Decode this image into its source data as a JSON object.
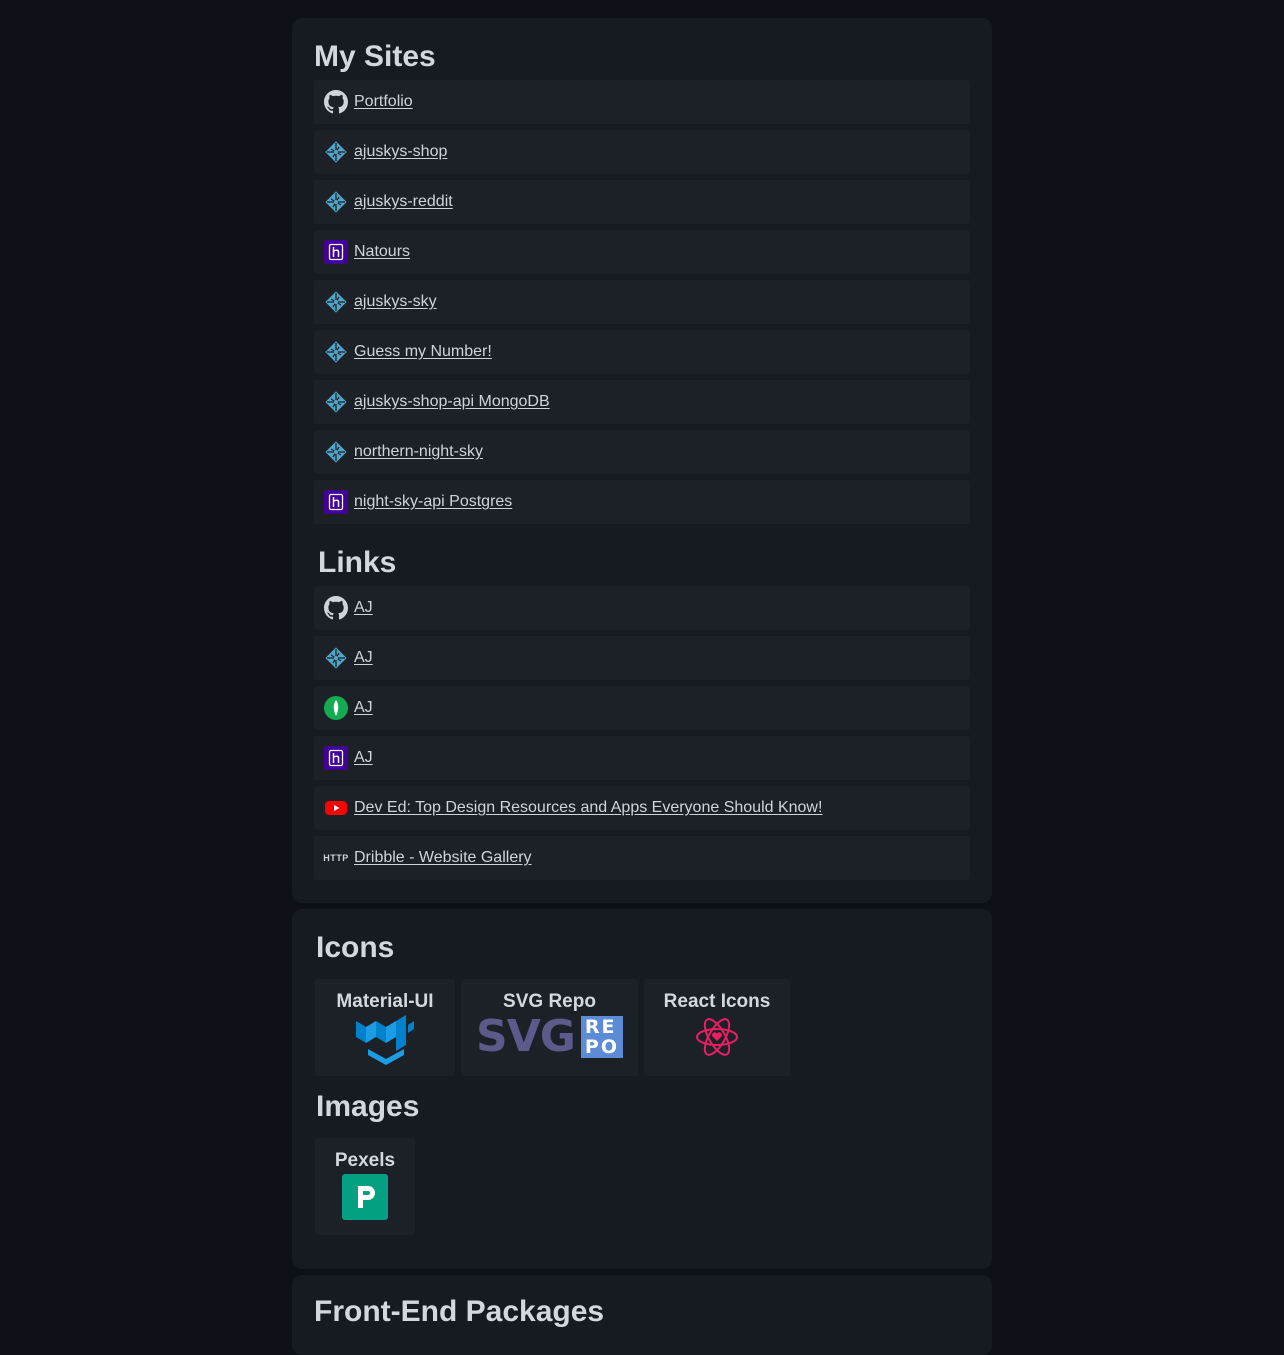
{
  "sites": {
    "title": "My Sites",
    "items": [
      {
        "label": "Portfolio",
        "icon": "github-icon"
      },
      {
        "label": "ajuskys-shop",
        "icon": "netlify-icon"
      },
      {
        "label": "ajuskys-reddit",
        "icon": "netlify-icon"
      },
      {
        "label": "Natours",
        "icon": "heroku-icon"
      },
      {
        "label": "ajuskys-sky",
        "icon": "netlify-icon"
      },
      {
        "label": "Guess my Number!",
        "icon": "netlify-icon"
      },
      {
        "label": "ajuskys-shop-api MongoDB",
        "icon": "netlify-icon"
      },
      {
        "label": "northern-night-sky",
        "icon": "netlify-icon"
      },
      {
        "label": "night-sky-api Postgres",
        "icon": "heroku-icon"
      }
    ]
  },
  "links": {
    "title": "Links",
    "items": [
      {
        "label": "AJ",
        "icon": "github-icon"
      },
      {
        "label": "AJ",
        "icon": "netlify-icon"
      },
      {
        "label": "AJ",
        "icon": "mongodb-icon"
      },
      {
        "label": "AJ",
        "icon": "heroku-icon"
      },
      {
        "label": "Dev Ed: Top Design Resources and Apps Everyone Should Know!",
        "icon": "youtube-icon"
      },
      {
        "label": "Dribble - Website Gallery",
        "icon": "http-icon"
      }
    ]
  },
  "icons_section": {
    "title": "Icons",
    "tiles": [
      {
        "label": "Material-UI",
        "icon": "material-ui-logo"
      },
      {
        "label": "SVG Repo",
        "icon": "svg-repo-logo",
        "logo_text": "SVG",
        "logo_badge": [
          "RE",
          "PO"
        ]
      },
      {
        "label": "React Icons",
        "icon": "react-icons-logo"
      }
    ]
  },
  "images_section": {
    "title": "Images",
    "tiles": [
      {
        "label": "Pexels",
        "icon": "pexels-logo"
      }
    ]
  },
  "packages": {
    "title": "Front-End Packages"
  },
  "http_icon_text": "HTTP",
  "colors": {
    "background": "#0d1117",
    "card": "#161b22",
    "row": "#1c2127",
    "text": "#d0d4d9",
    "netlify": "#4fa6c8",
    "heroku": "#430098",
    "mongodb": "#13aa52",
    "youtube": "#ff0000",
    "material_ui": "#0081cb",
    "svg_repo": "#5b5a8a",
    "react_icons": "#e91e63",
    "pexels": "#05a081"
  }
}
